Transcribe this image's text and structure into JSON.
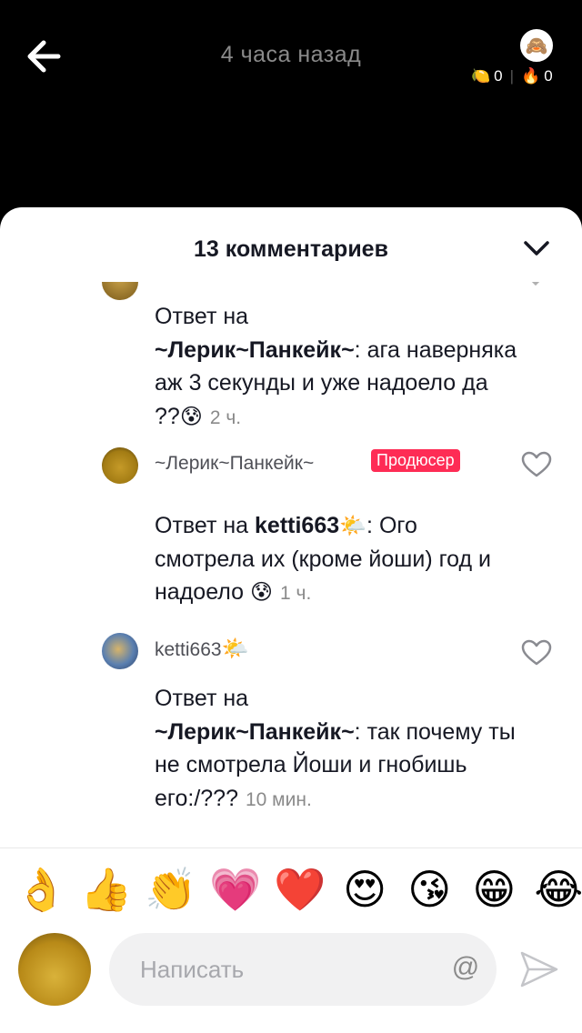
{
  "header": {
    "time_ago": "4 часа назад",
    "stats": {
      "coins": "0",
      "fires": "0",
      "coin_icon": "🍋",
      "fire_icon": "🔥"
    },
    "author_avatar_emoji": "🙈"
  },
  "sheet": {
    "title": "13 комментариев"
  },
  "comments": [
    {
      "reply_prefix": "Ответ на",
      "reply_to": "~Лерик~Панкейк~",
      "text": ": ага наверняка аж 3 секунды и уже надоело да ??",
      "emoji": "😰",
      "time": "2 ч."
    },
    {
      "author": "~Лерик~Панкейк~",
      "badge": "Продюсер",
      "reply_prefix": "Ответ на",
      "reply_to": "ketti663",
      "reply_to_emoji": "🌤️",
      "text": ": Ого смотрела их (кроме йоши) год и надоело",
      "emoji": "😰",
      "time": "1 ч."
    },
    {
      "author": "ketti663",
      "author_emoji": "🌤️",
      "reply_prefix": "Ответ на",
      "reply_to": "~Лерик~Панкейк~",
      "text": ": так почему ты не смотрела Йоши и гнобишь его:/???",
      "time": "10 мин."
    }
  ],
  "emoji_bar": [
    "👌",
    "👍",
    "👏",
    "💗",
    "❤️",
    "😍",
    "😘",
    "😁",
    "😂"
  ],
  "composer": {
    "placeholder": "Написать",
    "at_symbol": "@"
  }
}
